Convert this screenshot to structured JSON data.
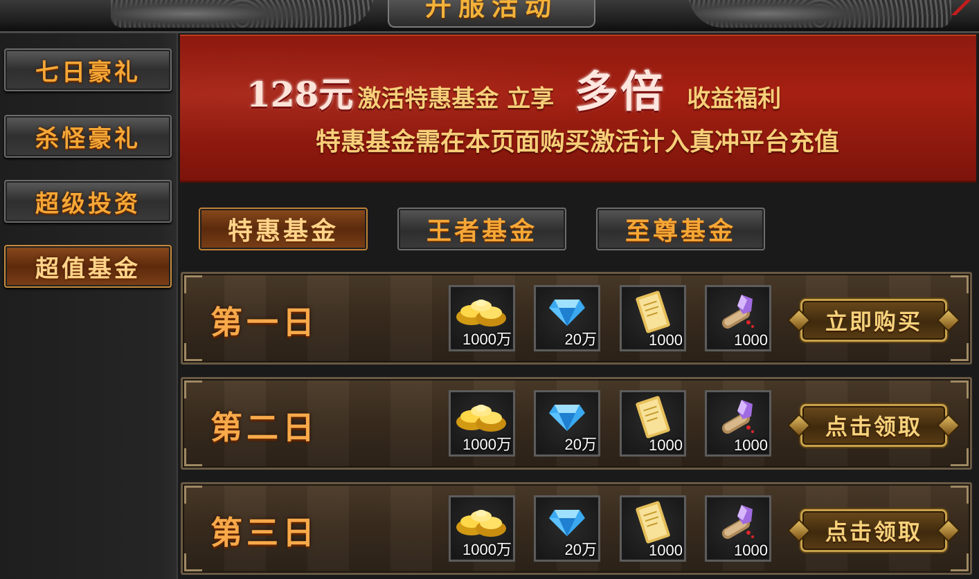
{
  "header": {
    "title": "开服活动"
  },
  "sidebar": {
    "items": [
      {
        "label": "七日豪礼",
        "active": false
      },
      {
        "label": "杀怪豪礼",
        "active": false
      },
      {
        "label": "超级投资",
        "active": false
      },
      {
        "label": "超值基金",
        "active": true
      }
    ]
  },
  "banner": {
    "price": "128元",
    "text1": "激活特惠基金 立享",
    "highlight": "多倍",
    "text2": "收益福利",
    "line2": "特惠基金需在本页面购买激活计入真冲平台充值"
  },
  "tabs": [
    {
      "label": "特惠基金",
      "active": true
    },
    {
      "label": "王者基金",
      "active": false
    },
    {
      "label": "至尊基金",
      "active": false
    }
  ],
  "rows": [
    {
      "day": "第一日",
      "items": [
        {
          "icon": "gold-ingot-icon",
          "qty": "1000万"
        },
        {
          "icon": "diamond-icon",
          "qty": "20万"
        },
        {
          "icon": "gold-ticket-icon",
          "qty": "1000"
        },
        {
          "icon": "scroll-crystal-icon",
          "qty": "1000"
        }
      ],
      "button": "立即购买"
    },
    {
      "day": "第二日",
      "items": [
        {
          "icon": "gold-ingot-icon",
          "qty": "1000万"
        },
        {
          "icon": "diamond-icon",
          "qty": "20万"
        },
        {
          "icon": "gold-ticket-icon",
          "qty": "1000"
        },
        {
          "icon": "scroll-crystal-icon",
          "qty": "1000"
        }
      ],
      "button": "点击领取"
    },
    {
      "day": "第三日",
      "items": [
        {
          "icon": "gold-ingot-icon",
          "qty": "1000万"
        },
        {
          "icon": "diamond-icon",
          "qty": "20万"
        },
        {
          "icon": "gold-ticket-icon",
          "qty": "1000"
        },
        {
          "icon": "scroll-crystal-icon",
          "qty": "1000"
        }
      ],
      "button": "点击领取"
    }
  ],
  "colors": {
    "accent": "#f5a736",
    "banner_red": "#a52012",
    "row_bg": "#3b2d1f"
  }
}
